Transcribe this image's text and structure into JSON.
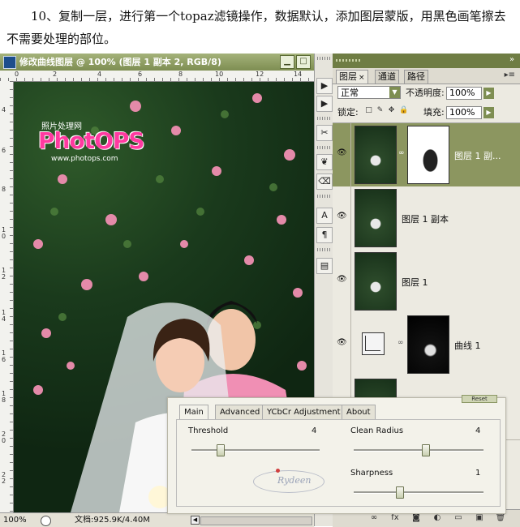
{
  "instruction": "10、复制一层，进行第一个topaz滤镜操作，数据默认，添加图层蒙版，用黑色画笔擦去不需要处理的部位。",
  "document": {
    "title": "修改曲线图层 @ 100% (图层 1 副本 2, RGB/8)",
    "minimize": "▁",
    "maximize": "□",
    "ruler_top_marks": [
      "0",
      "2",
      "4",
      "6",
      "8",
      "10",
      "12",
      "14"
    ],
    "ruler_left_marks": [
      "4",
      "6",
      "8",
      "10",
      "12",
      "14",
      "16",
      "18",
      "20",
      "22"
    ],
    "watermark": {
      "subtitle": "照片处理网",
      "logo": "PhotOPS",
      "url": "www.photops.com"
    },
    "status": {
      "zoom": "100%",
      "doc_size": "文档:925.9K/4.40M",
      "arrow": "◀"
    }
  },
  "tools": [
    "▶",
    "▶",
    "✂",
    "❦",
    "⌫",
    "A",
    "¶",
    "▤"
  ],
  "layers_panel": {
    "tabs": [
      "图层",
      "通道",
      "路径"
    ],
    "tab_close": "×",
    "menu_arrow": "▸≡",
    "blend_mode": "正常",
    "opacity_label": "不透明度:",
    "opacity_value": "100%",
    "lock_label": "锁定:",
    "fill_label": "填充:",
    "fill_value": "100%",
    "lock_icons": [
      "□",
      "✎",
      "✥",
      "🔒"
    ],
    "layers": [
      {
        "name": "图层 1 副...",
        "visible": true,
        "selected": true,
        "has_mask": true
      },
      {
        "name": "图层 1 副本",
        "visible": true,
        "selected": false,
        "has_mask": false
      },
      {
        "name": "图层 1",
        "visible": true,
        "selected": false,
        "has_mask": false
      },
      {
        "name": "曲线 1",
        "visible": true,
        "selected": false,
        "has_mask": true,
        "adjustment": true
      }
    ],
    "bottom_icons": [
      "∞",
      "fx",
      "◙",
      "◐",
      "▭",
      "▣",
      "🗑"
    ]
  },
  "topaz": {
    "partial_button": "Reset",
    "tabs": [
      "Main",
      "Advanced",
      "YCbCr Adjustment",
      "About"
    ],
    "active_tab": "Main",
    "params": {
      "threshold": {
        "label": "Threshold",
        "value": "4",
        "level": 0.22
      },
      "clean_radius": {
        "label": "Clean Radius",
        "value": "4",
        "level": 0.55
      },
      "sharpness": {
        "label": "Sharpness",
        "value": "1",
        "level": 0.35
      }
    },
    "signature": "Rydeen"
  },
  "colors": {
    "panel_green": "#6f7d44",
    "selected_layer": "#8c9660",
    "logo_pink": "#ff3aa0"
  }
}
